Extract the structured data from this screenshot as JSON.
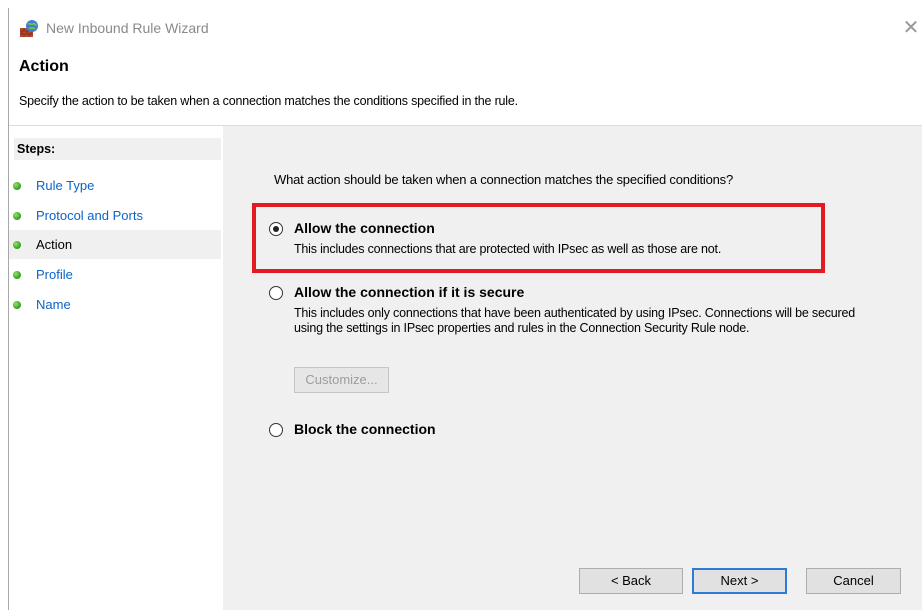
{
  "window": {
    "title": "New Inbound Rule Wizard",
    "close_glyph": "✕",
    "icon": "firewall-wizard-icon"
  },
  "header": {
    "title": "Action",
    "description": "Specify the action to be taken when a connection matches the conditions specified in the rule."
  },
  "steps": {
    "label": "Steps:",
    "items": [
      {
        "label": "Rule Type",
        "current": false
      },
      {
        "label": "Protocol and Ports",
        "current": false
      },
      {
        "label": "Action",
        "current": true
      },
      {
        "label": "Profile",
        "current": false
      },
      {
        "label": "Name",
        "current": false
      }
    ]
  },
  "main": {
    "question": "What action should be taken when a connection matches the specified conditions?",
    "options": [
      {
        "title": "Allow the connection",
        "description": "This includes connections that are protected with IPsec as well as those are not.",
        "selected": true
      },
      {
        "title": "Allow the connection if it is secure",
        "description": "This includes only connections that have been authenticated by using IPsec.  Connections will be secured using the settings in IPsec properties and rules in the Connection Security Rule node.",
        "selected": false
      },
      {
        "title": "Block the connection",
        "description": "",
        "selected": false
      }
    ],
    "customize_label": "Customize..."
  },
  "buttons": {
    "back": "< Back",
    "next": "Next >",
    "cancel": "Cancel"
  },
  "colors": {
    "highlight": "#e21b23",
    "link": "#0a64c8",
    "panel_bg": "#f0f0f0"
  }
}
